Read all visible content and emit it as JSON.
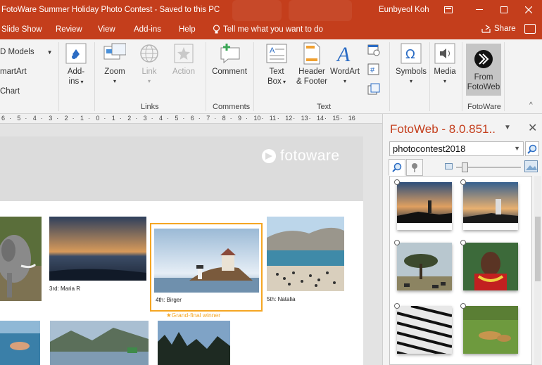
{
  "window": {
    "title": "FotoWare Summer Holiday Photo Contest  -  Saved to this PC",
    "user": "Eunbyeol Koh",
    "controls": {
      "restore_icon": "ribbon-display-icon",
      "minimize": "minimize-icon",
      "maximize": "maximize-icon",
      "close": "close-icon"
    }
  },
  "tabs": [
    "Slide Show",
    "Review",
    "View",
    "Add-ins",
    "Help"
  ],
  "tell_me": "Tell me what you want to do",
  "share": "Share",
  "ribbon": {
    "insert_small": [
      "D Models",
      "martArt",
      "Chart"
    ],
    "addins": {
      "label": "Add-",
      "label2": "ins"
    },
    "zoom": "Zoom",
    "link": "Link",
    "action": "Action",
    "comment": "Comment",
    "textbox": {
      "label": "Text",
      "label2": "Box"
    },
    "header_footer": {
      "label": "Header",
      "label2": "& Footer"
    },
    "wordart": "WordArt",
    "symbols": "Symbols",
    "media": "Media",
    "from_fotoweb": {
      "label": "From",
      "label2": "FotoWeb"
    },
    "groups": {
      "links": "Links",
      "comments": "Comments",
      "text": "Text",
      "fotoware": "FotoWare"
    }
  },
  "ruler_labels": [
    "6",
    "5",
    "4",
    "3",
    "2",
    "1",
    "0",
    "1",
    "2",
    "3",
    "4",
    "5",
    "6",
    "7",
    "8",
    "9",
    "10",
    "11",
    "12",
    "13",
    "14",
    "15",
    "16"
  ],
  "slide": {
    "brand": "fotoware",
    "captions": {
      "third": "3rd: Maria R",
      "fourth": "4th: Birger",
      "fifth": "5th: Natalia"
    },
    "winner_note": "★Grand-final winner"
  },
  "pane": {
    "title": "FotoWeb - 8.0.851..",
    "search_value": "photocontest2018",
    "zoom_slider_value": 0.1
  },
  "colors": {
    "accent": "#c43e1c",
    "winner": "#f5a623"
  }
}
